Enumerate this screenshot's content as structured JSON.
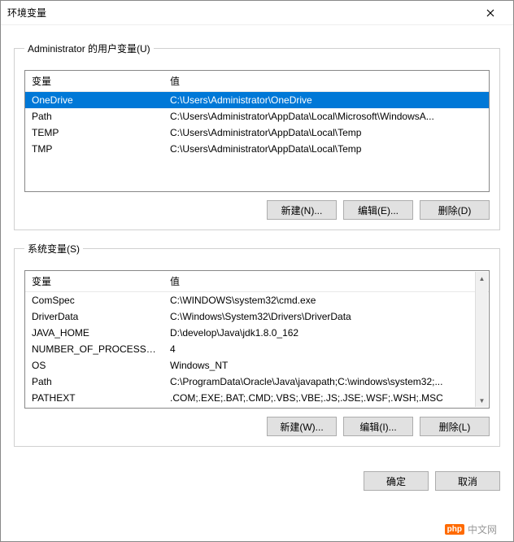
{
  "window": {
    "title": "环境变量"
  },
  "user_section": {
    "legend": "Administrator 的用户变量(U)",
    "columns": {
      "name": "变量",
      "value": "值"
    },
    "rows": [
      {
        "name": "OneDrive",
        "value": "C:\\Users\\Administrator\\OneDrive",
        "selected": true
      },
      {
        "name": "Path",
        "value": "C:\\Users\\Administrator\\AppData\\Local\\Microsoft\\WindowsA...",
        "selected": false
      },
      {
        "name": "TEMP",
        "value": "C:\\Users\\Administrator\\AppData\\Local\\Temp",
        "selected": false
      },
      {
        "name": "TMP",
        "value": "C:\\Users\\Administrator\\AppData\\Local\\Temp",
        "selected": false
      }
    ],
    "buttons": {
      "new": "新建(N)...",
      "edit": "编辑(E)...",
      "delete": "删除(D)"
    }
  },
  "system_section": {
    "legend": "系统变量(S)",
    "columns": {
      "name": "变量",
      "value": "值"
    },
    "rows": [
      {
        "name": "ComSpec",
        "value": "C:\\WINDOWS\\system32\\cmd.exe"
      },
      {
        "name": "DriverData",
        "value": "C:\\Windows\\System32\\Drivers\\DriverData"
      },
      {
        "name": "JAVA_HOME",
        "value": "D:\\develop\\Java\\jdk1.8.0_162"
      },
      {
        "name": "NUMBER_OF_PROCESSORS",
        "value": "4"
      },
      {
        "name": "OS",
        "value": "Windows_NT"
      },
      {
        "name": "Path",
        "value": "C:\\ProgramData\\Oracle\\Java\\javapath;C:\\windows\\system32;..."
      },
      {
        "name": "PATHEXT",
        "value": ".COM;.EXE;.BAT;.CMD;.VBS;.VBE;.JS;.JSE;.WSF;.WSH;.MSC"
      }
    ],
    "buttons": {
      "new": "新建(W)...",
      "edit": "编辑(I)...",
      "delete": "删除(L)"
    }
  },
  "footer": {
    "ok": "确定",
    "cancel": "取消"
  },
  "watermark": {
    "badge": "php",
    "text": "中文网"
  }
}
